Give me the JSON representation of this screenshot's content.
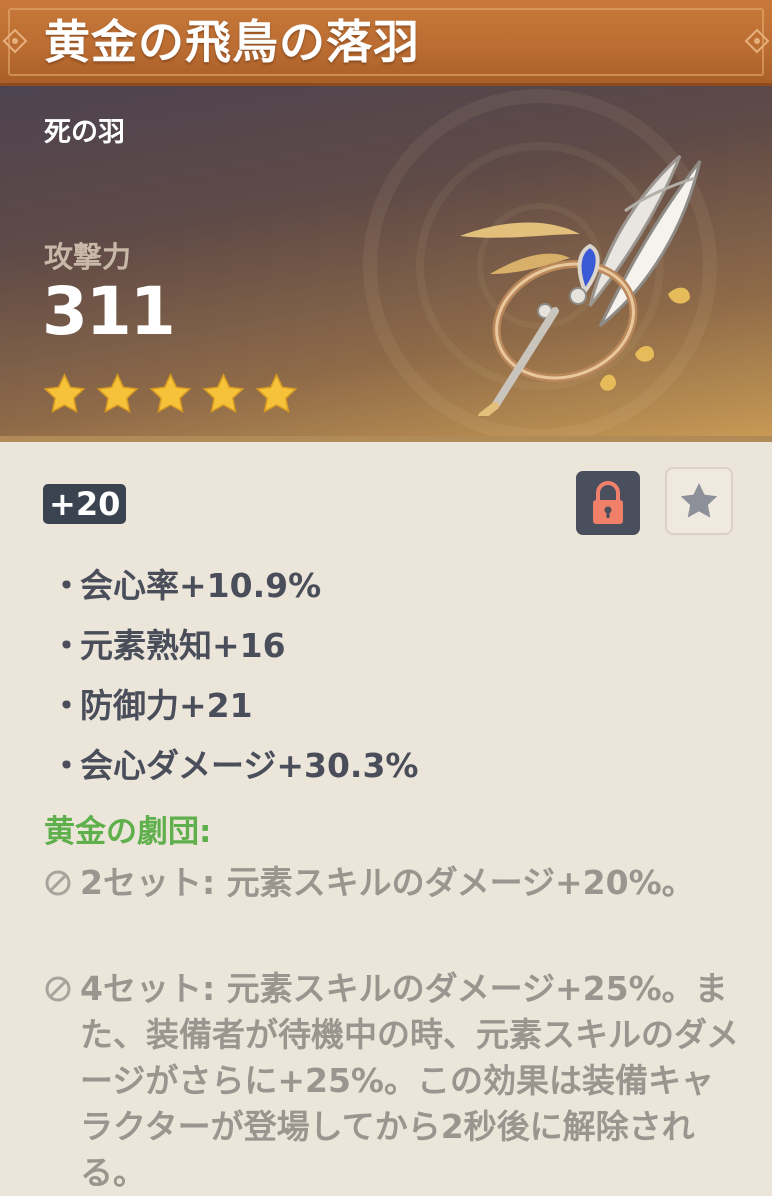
{
  "artifact": {
    "name": "黄金の飛鳥の落羽",
    "slot": "死の羽",
    "main_stat_label": "攻撃力",
    "main_stat_value": "311",
    "rarity": 5,
    "level": "+20",
    "locked": true,
    "favorited": false
  },
  "substats": [
    {
      "bullet": "・",
      "text": "会心率+10.9%"
    },
    {
      "bullet": "・",
      "text": "元素熟知+16"
    },
    {
      "bullet": "・",
      "text": "防御力+21"
    },
    {
      "bullet": "・",
      "text": "会心ダメージ+30.3%"
    }
  ],
  "set": {
    "name": "黄金の劇団:",
    "bonus_2": "2セット: 元素スキルのダメージ+20%。",
    "bonus_4": "4セット: 元素スキルのダメージ+25%。また、装備者が待機中の時、元素スキルのダメージがさらに+25%。この効果は装備キャラクターが登場してから2秒後に解除される。"
  },
  "icons": {
    "lock": "lock-icon",
    "favorite": "star-icon",
    "rarity": "star-icon",
    "inactive": "ban-icon"
  },
  "colors": {
    "title_bar": "#bb6d32",
    "set_name": "#5fb04c",
    "star": "#f5c23a",
    "lock_icon": "#f0806a",
    "level_badge": "#3b4250"
  }
}
